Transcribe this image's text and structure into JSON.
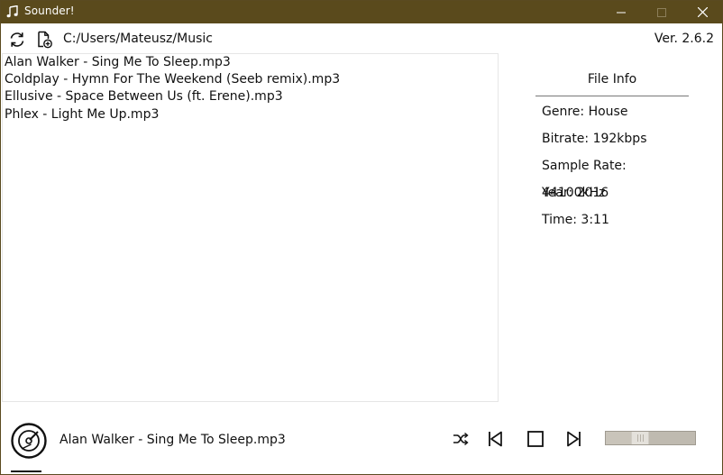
{
  "window": {
    "title": "Sounder!",
    "title_bar_color": "#5a4a1c"
  },
  "toolbar": {
    "refresh_icon": "refresh-icon",
    "add_file_icon": "add-file-icon",
    "path": "C:/Users/Mateusz/Music",
    "version": "Ver. 2.6.2"
  },
  "songs": [
    "Alan Walker - Sing Me To Sleep.mp3",
    "Coldplay - Hymn For The Weekend (Seeb remix).mp3",
    "Ellusive - Space Between Us (ft. Erene).mp3",
    "Phlex - Light Me Up.mp3"
  ],
  "file_info": {
    "header": "File Info",
    "genre": "Genre: House",
    "bitrate": "Bitrate: 192kbps",
    "sample_rate": "Sample Rate: 44100kHz",
    "year": "Year: 2016",
    "time": "Time: 3:11"
  },
  "player": {
    "disc_icon": "disc-icon",
    "now_playing": "Alan Walker - Sing Me To Sleep.mp3",
    "controls": [
      "shuffle-icon",
      "previous-icon",
      "stop-icon",
      "next-icon"
    ],
    "volume": 0.38
  }
}
